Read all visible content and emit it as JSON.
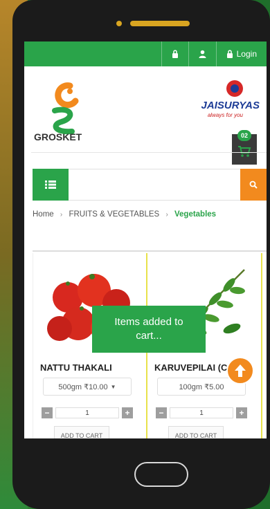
{
  "topbar": {
    "lock_icon": "lock-icon",
    "user_icon": "user-icon",
    "login_label": "Login"
  },
  "header": {
    "logo_text": "GROSKET",
    "partner_brand": "JAISURYAS",
    "partner_tagline": "always for you"
  },
  "cart": {
    "count": "02"
  },
  "search": {
    "placeholder": ""
  },
  "breadcrumb": {
    "home": "Home",
    "category": "FRUITS & VEGETABLES",
    "current": "Vegetables"
  },
  "products": [
    {
      "name": "NATTU THAKALI",
      "variant": "500gm ₹10.00",
      "qty": "1",
      "add_label": "ADD TO CART"
    },
    {
      "name": "KARUVEPILAI (C",
      "variant": "100gm ₹5.00",
      "qty": "1",
      "add_label": "ADD TO CART"
    }
  ],
  "toast": {
    "message": "Items added to cart..."
  },
  "colors": {
    "accent_green": "#2aa44a",
    "accent_orange": "#f28a1e"
  }
}
